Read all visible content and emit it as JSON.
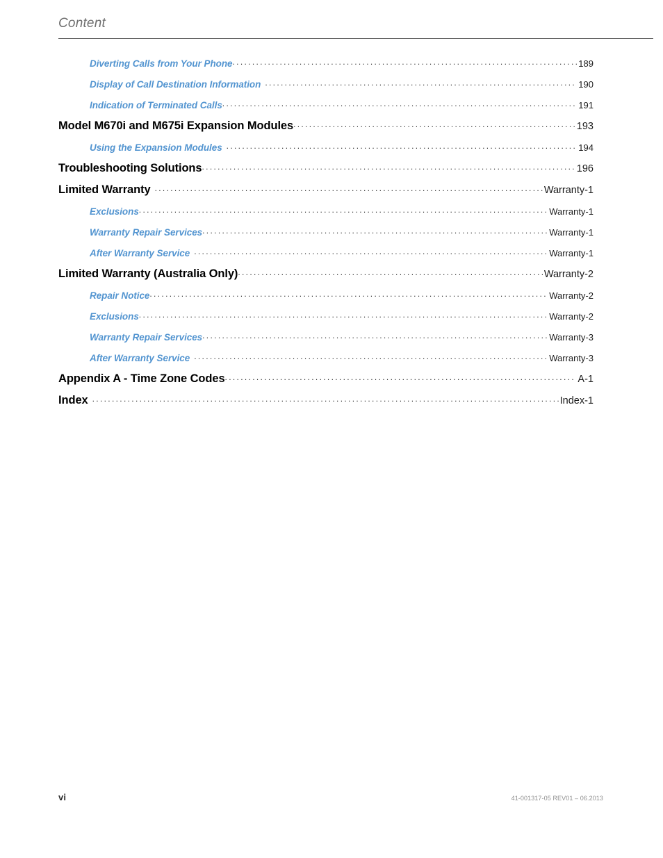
{
  "header": {
    "title": "Content"
  },
  "toc": {
    "entries": [
      {
        "label": "Diverting Calls from Your Phone",
        "page": "189",
        "level": 2,
        "gap": false
      },
      {
        "label": "Display of Call Destination Information",
        "page": "190",
        "level": 2,
        "gap": true
      },
      {
        "label": "Indication of Terminated Calls",
        "page": "191",
        "level": 2,
        "gap": false
      },
      {
        "label": "Model M670i and M675i Expansion Modules",
        "page": "193",
        "level": 1,
        "gap": false
      },
      {
        "label": "Using the Expansion Modules",
        "page": "194",
        "level": 2,
        "gap": true
      },
      {
        "label": "Troubleshooting Solutions",
        "page": "196",
        "level": 1,
        "gap": false
      },
      {
        "label": "Limited Warranty",
        "page": "Warranty-1",
        "level": 1,
        "gap": true
      },
      {
        "label": "Exclusions",
        "page": "Warranty-1",
        "level": 2,
        "gap": false
      },
      {
        "label": "Warranty Repair Services",
        "page": "Warranty-1",
        "level": 2,
        "gap": false
      },
      {
        "label": "After Warranty Service",
        "page": "Warranty-1",
        "level": 2,
        "gap": true
      },
      {
        "label": "Limited Warranty (Australia Only)",
        "page": "Warranty-2",
        "level": 1,
        "gap": false
      },
      {
        "label": "Repair Notice",
        "page": "Warranty-2",
        "level": 2,
        "gap": false
      },
      {
        "label": "Exclusions",
        "page": "Warranty-2",
        "level": 2,
        "gap": false
      },
      {
        "label": "Warranty Repair Services",
        "page": "Warranty-3",
        "level": 2,
        "gap": false
      },
      {
        "label": "After Warranty Service",
        "page": "Warranty-3",
        "level": 2,
        "gap": true
      },
      {
        "label": "Appendix A - Time Zone Codes",
        "page": "A-1",
        "level": 1,
        "gap": false
      },
      {
        "label": "Index",
        "page": "Index-1",
        "level": 1,
        "gap": true
      }
    ]
  },
  "footer": {
    "folio": "vi",
    "doc_id": "41-001317-05 REV01 – 06.2013"
  },
  "colors": {
    "section_link": "#5294d0",
    "chapter_text": "#000000",
    "header_text": "#6e6e6e",
    "rule": "#595959",
    "footer_doc_id": "#8e8e8e"
  }
}
